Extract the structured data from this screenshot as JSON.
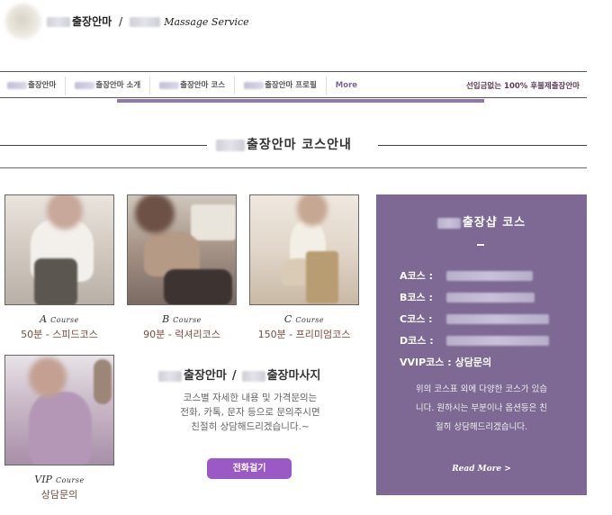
{
  "header": {
    "brand_name": "출장안마",
    "brand_sep": "/",
    "brand_service": "Massage Service"
  },
  "nav": {
    "items": [
      {
        "label": "출장안마"
      },
      {
        "label": "출장안마 소개"
      },
      {
        "label": "출장안마 코스"
      },
      {
        "label": "출장안마 프로필"
      }
    ],
    "more": "More",
    "tagline": "선입금없는 100% 후불제출장안마"
  },
  "section": {
    "title": "출장안마 코스안내"
  },
  "courses": [
    {
      "letter": "A",
      "course_word": "Course",
      "name": "50분 - 스피드코스"
    },
    {
      "letter": "B",
      "course_word": "Course",
      "name": "90분 - 럭셔리코스"
    },
    {
      "letter": "C",
      "course_word": "Course",
      "name": "150분 - 프리미엄코스"
    },
    {
      "letter": "VIP",
      "course_word": "Course",
      "name": "상담문의"
    }
  ],
  "contact": {
    "title_left": "출장안마",
    "title_sep": "/",
    "title_right": "출장마사지",
    "desc_line1": "코스별 자세한 내용 및 가격문의는",
    "desc_line2": "전화, 카톡, 문자 등으로 문의주시면",
    "desc_line3": "친절히 상담해드리겠습니다.~",
    "button": "전화걸기"
  },
  "panel": {
    "title": "출장샵 코스",
    "rows": [
      {
        "label": "A코스 :",
        "value": ""
      },
      {
        "label": "B코스 :",
        "value": ""
      },
      {
        "label": "C코스 :",
        "value": ""
      },
      {
        "label": "D코스 :",
        "value": ""
      },
      {
        "label": "VVIP코스 :",
        "value": "상담문의"
      }
    ],
    "note_line1": "위의 코스표 외에 다양한 코스가 있습",
    "note_line2": "니다. 원하시는 부분이나 옵션등은 친",
    "note_line3": "절히 상담해드리겠습니다.",
    "read_more": "Read More >"
  },
  "colors": {
    "accent_purple": "#7d6993",
    "nav_bar": "#8f79a7",
    "button": "#9b59c6",
    "course_name": "#7a4a3e"
  }
}
